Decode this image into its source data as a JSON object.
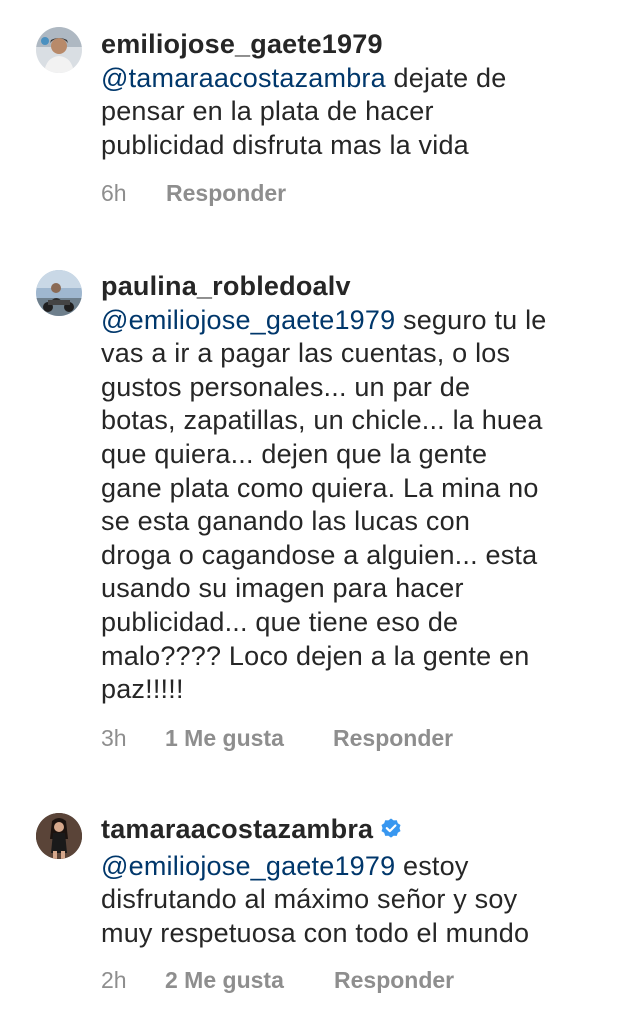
{
  "comments": [
    {
      "username": "emiliojose_gaete1979",
      "verified": false,
      "mention": "@tamaraacostazambra",
      "lines": [
        " dejate de",
        "pensar en la plata de hacer",
        "publicidad disfruta mas la vida"
      ],
      "time": "6h",
      "likes": "",
      "reply_label": "Responder"
    },
    {
      "username": "paulina_robledoalv",
      "verified": false,
      "mention": "@emiliojose_gaete1979",
      "lines": [
        " seguro tu le",
        "vas a ir a pagar las cuentas, o los",
        "gustos personales... un par de",
        "botas, zapatillas, un chicle... la huea",
        "que quiera... dejen que la gente",
        "gane plata como quiera. La mina no",
        "se esta ganando las lucas con",
        "droga o cagandose a alguien... esta",
        "usando su imagen para hacer",
        "publicidad... que tiene eso de",
        "malo???? Loco dejen a la gente en",
        "paz!!!!!"
      ],
      "time": "3h",
      "likes": "1 Me gusta",
      "reply_label": "Responder"
    },
    {
      "username": "tamaraacostazambra",
      "verified": true,
      "mention": "@emiliojose_gaete1979",
      "lines": [
        " estoy",
        "disfrutando al máximo señor y soy",
        "muy respetuosa con todo el mundo"
      ],
      "time": "2h",
      "likes": "2 Me gusta",
      "reply_label": "Responder"
    }
  ],
  "colors": {
    "text": "#262626",
    "mention": "#00376b",
    "meta": "#8e8e8e",
    "verified": "#3897f0"
  }
}
